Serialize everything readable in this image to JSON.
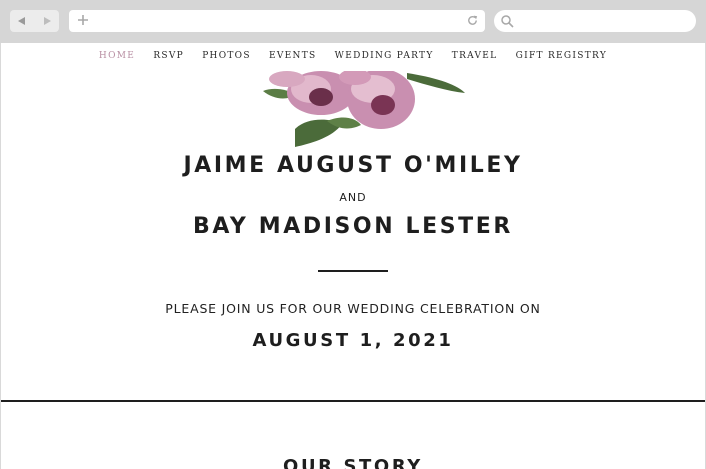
{
  "browser": {
    "back_icon": "back-arrow-icon",
    "forward_icon": "forward-arrow-icon",
    "new_tab_icon": "plus-icon",
    "reload_icon": "reload-icon",
    "search_icon": "search-icon"
  },
  "nav": {
    "items": [
      "HOME",
      "RSVP",
      "PHOTOS",
      "EVENTS",
      "WEDDING PARTY",
      "TRAVEL",
      "GIFT REGISTRY"
    ],
    "active_index": 0,
    "active_color": "#b88fa3"
  },
  "hero": {
    "name1": "JAIME AUGUST O'MILEY",
    "and": "AND",
    "name2": "BAY MADISON LESTER",
    "invite": "PLEASE JOIN US FOR OUR WEDDING CELEBRATION ON",
    "date": "AUGUST 1, 2021"
  },
  "story": {
    "title": "OUR STORY"
  },
  "colors": {
    "text": "#1e1e1e",
    "peony": "#c98fb0",
    "leaf": "#4b6b3a"
  }
}
